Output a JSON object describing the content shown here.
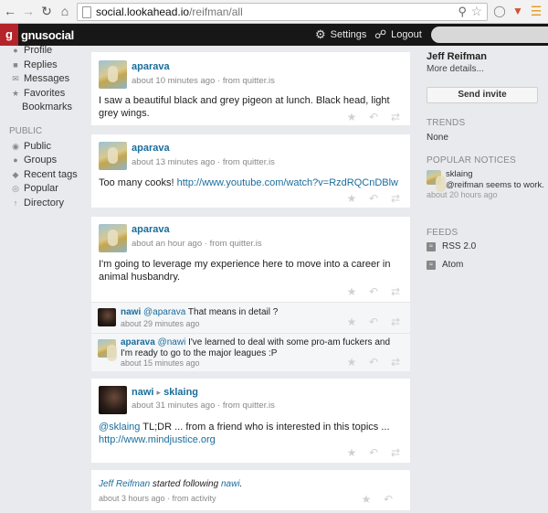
{
  "browser": {
    "url_host": "social.lookahead.io",
    "url_path": "/reifman/all"
  },
  "header": {
    "logo_mark": "g",
    "logo_text": "gnusocial",
    "settings_label": "Settings",
    "logout_label": "Logout"
  },
  "left_nav": {
    "personal_items": [
      "Profile",
      "Replies",
      "Messages",
      "Favorites",
      "Bookmarks"
    ],
    "public_heading": "PUBLIC",
    "public_items": [
      "Public",
      "Groups",
      "Recent tags",
      "Popular",
      "Directory"
    ]
  },
  "notices": [
    {
      "author": "aparava",
      "meta": "about 10 minutes ago · from quitter.is",
      "content": "I saw a beautiful black and grey pigeon at lunch. Black head, light grey wings."
    },
    {
      "author": "aparava",
      "meta": "about 13 minutes ago · from quitter.is",
      "content_prefix": "Too many cooks! ",
      "link": "http://www.youtube.com/watch?v=RzdRQCnDBlw"
    },
    {
      "author": "aparava",
      "meta": "about an hour ago · from quitter.is",
      "content": "I'm going to leverage my experience here to move into a career in animal husbandry.",
      "replies": [
        {
          "author": "nawi",
          "mention": "@aparava",
          "content": " That means in detail ?",
          "meta": "about 29 minutes ago"
        },
        {
          "author": "aparava",
          "mention": "@nawi",
          "content": " I've learned to deal with some pro-am fuckers and I'm ready to go to the major leagues :P",
          "meta": "about 15 minutes ago"
        }
      ]
    },
    {
      "author": "nawi",
      "arrow": "▸",
      "recipient": "sklaing",
      "meta": "about 31 minutes ago · from quitter.is",
      "mention": "@sklaing",
      "content": " TL;DR ... from a friend who is interested in this topics ...",
      "link": "http://www.mindjustice.org"
    },
    {
      "actor": "Jeff Reifman",
      "action": " started following ",
      "target": "nawi",
      "end": ".",
      "meta": "about 3 hours ago · from activity"
    }
  ],
  "right_col": {
    "profile_name": "Jeff Reifman",
    "more_details": "More details...",
    "send_invite": "Send invite",
    "trends_heading": "TRENDS",
    "trends_value": "None",
    "popular_heading": "POPULAR NOTICES",
    "popular": {
      "author": "sklaing",
      "text": "@reifman seems to work.",
      "meta": "about 20 hours ago"
    },
    "feeds_heading": "FEEDS",
    "feeds": [
      "RSS 2.0",
      "Atom"
    ]
  }
}
